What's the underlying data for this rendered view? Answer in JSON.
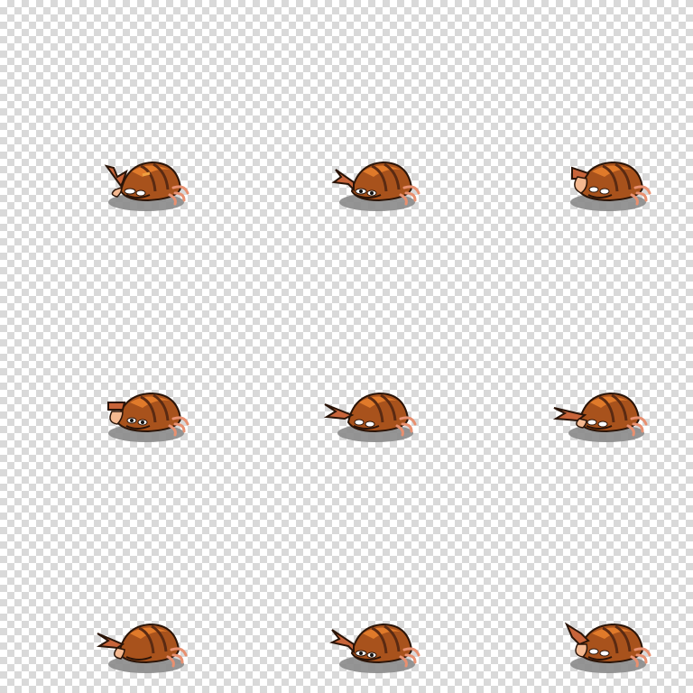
{
  "sheet": {
    "columns": 3,
    "rows": 3,
    "background": "transparency-checkerboard",
    "palette": {
      "shell_dark": "#5a2a12",
      "shell_mid": "#a8521c",
      "shell_light": "#e07a2a",
      "stripe": "#f0a040",
      "claw": "#c8643a",
      "claw_light": "#f4b890",
      "leg": "#e89070",
      "eye_white": "#ffffff",
      "pupil": "#111111",
      "shadow": "#8a8a8a",
      "outline": "#2a1408"
    },
    "frames": [
      {
        "pose": "claw-raised-left"
      },
      {
        "pose": "claw-forward-left"
      },
      {
        "pose": "claw-front"
      },
      {
        "pose": "claw-front-open"
      },
      {
        "pose": "claw-extended-left"
      },
      {
        "pose": "claw-extended-far-left"
      },
      {
        "pose": "claw-raised-high-left"
      },
      {
        "pose": "claw-forward-left"
      },
      {
        "pose": "claw-front"
      }
    ]
  }
}
